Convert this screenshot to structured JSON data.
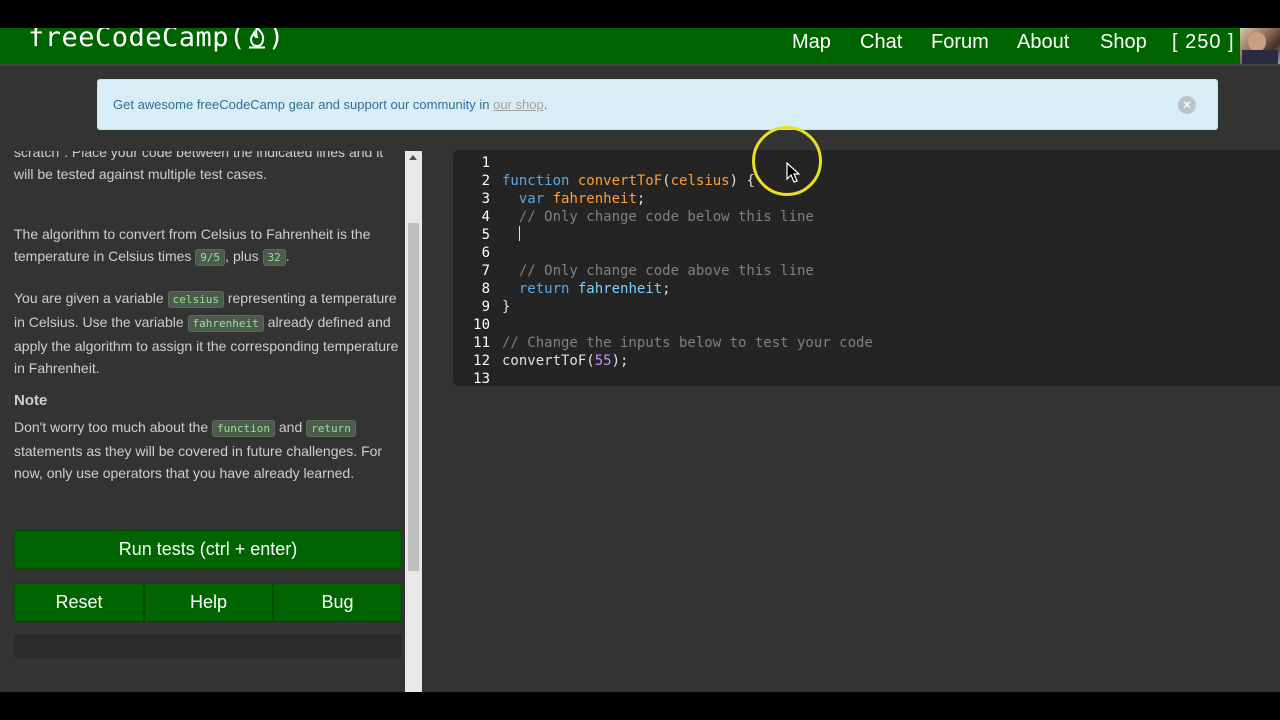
{
  "navbar": {
    "logo": "freeCodeCamp(",
    "logo_end": ")",
    "links": [
      "Map",
      "Chat",
      "Forum",
      "About",
      "Shop"
    ],
    "points": "[ 250 ]"
  },
  "banner": {
    "text": "Get awesome freeCodeCamp gear and support our community in ",
    "link_text": "our shop",
    "text_end": ".",
    "close_label": "×"
  },
  "instructions": {
    "p1_partial": "scratch\". Place your code between the indicated lines and it will be tested against multiple test cases.",
    "p2_a": "The algorithm to convert from Celsius to Fahrenheit is the temperature in Celsius times ",
    "p2_code1": "9/5",
    "p2_b": ", plus ",
    "p2_code2": "32",
    "p2_c": ".",
    "p3_a": "You are given a variable ",
    "p3_code1": "celsius",
    "p3_b": " representing a temperature in Celsius. Use the variable ",
    "p3_code2": "fahrenheit",
    "p3_c": " already defined and apply the algorithm to assign it the corresponding temperature in Fahrenheit.",
    "note_title": "Note",
    "note_a": "Don't worry too much about the ",
    "note_code1": "function",
    "note_b": " and ",
    "note_code2": "return",
    "note_c": " statements as they will be covered in future challenges. For now, only use operators that you have already learned."
  },
  "buttons": {
    "run": "Run tests (ctrl + enter)",
    "reset": "Reset",
    "help": "Help",
    "bug": "Bug"
  },
  "editor": {
    "line_numbers": [
      "1",
      "2",
      "3",
      "4",
      "5",
      "6",
      "7",
      "8",
      "9",
      "10",
      "11",
      "12",
      "13"
    ],
    "l2_kw": "function",
    "l2_fn": "convertToF",
    "l2_p1": "(",
    "l2_arg": "celsius",
    "l2_p2": ") {",
    "l3_kw": "var",
    "l3_var": "fahrenheit",
    "l3_end": ";",
    "l4_cm": "// Only change code below this line",
    "l7_cm": "// Only change code above this line",
    "l8_kw": "return",
    "l8_var": "fahrenheit",
    "l8_end": ";",
    "l9": "}",
    "l11_cm": "// Change the inputs below to test your code",
    "l12_fn": "convertToF",
    "l12_p1": "(",
    "l12_num": "55",
    "l12_p2": ");"
  }
}
